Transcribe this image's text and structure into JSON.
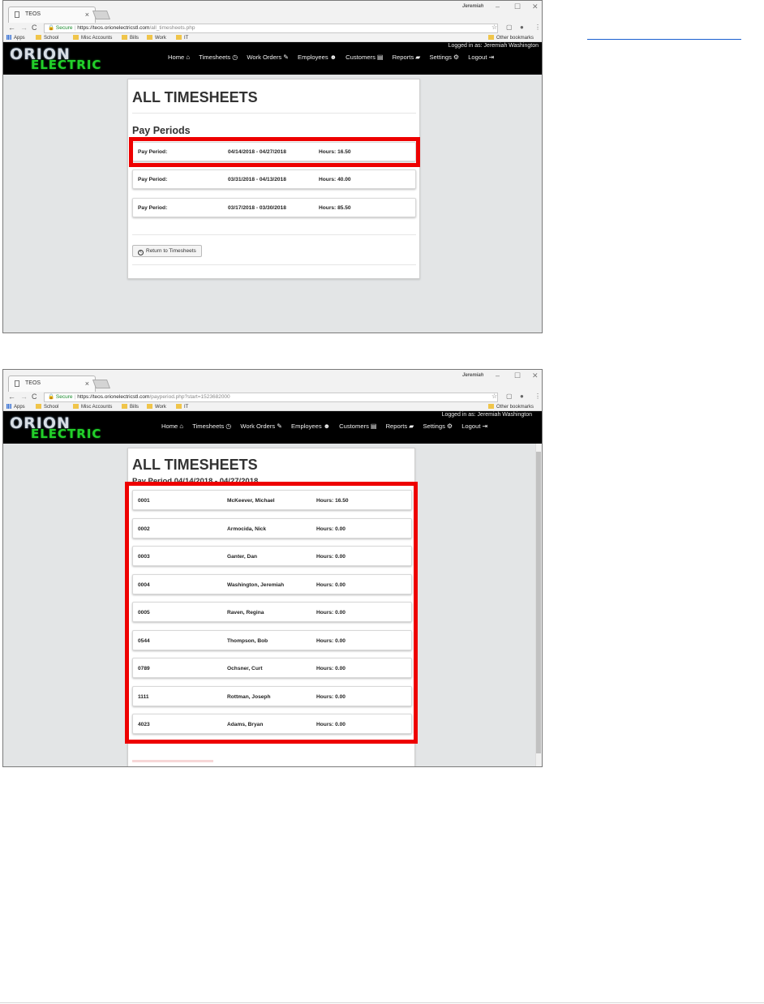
{
  "screenshot1": {
    "browser": {
      "tab_title": "TEOS",
      "user_label": "Jeremiah",
      "secure_label": "Secure",
      "url_host": "https://teos.orionelectricstl.com",
      "url_path": "/all_timesheets.php",
      "bookmarks": [
        "Apps",
        "School",
        "Misc Accounts",
        "Bills",
        "Work",
        "IT"
      ],
      "other_bookmarks": "Other bookmarks"
    },
    "site": {
      "logo_top": "ORION",
      "logo_bottom": "ELECTRIC",
      "logged_in": "Logged in as: Jeremiah Washington",
      "menu": [
        "Home",
        "Timesheets",
        "Work Orders",
        "Employees",
        "Customers",
        "Reports",
        "Settings",
        "Logout"
      ]
    },
    "page": {
      "title": "ALL TIMESHEETS",
      "subtitle": "Pay Periods",
      "periods": [
        {
          "label": "Pay Period:",
          "range": "04/14/2018 - 04/27/2018",
          "hours": "Hours: 16.50"
        },
        {
          "label": "Pay Period:",
          "range": "03/31/2018 - 04/13/2018",
          "hours": "Hours: 40.00"
        },
        {
          "label": "Pay Period:",
          "range": "03/17/2018 - 03/30/2018",
          "hours": "Hours: 85.50"
        }
      ],
      "return_button": "Return to Timesheets"
    }
  },
  "screenshot2": {
    "browser": {
      "tab_title": "TEOS",
      "user_label": "Jeremiah",
      "secure_label": "Secure",
      "url_host": "https://teos.orionelectricstl.com",
      "url_path": "/payperiod.php?start=1523682000",
      "bookmarks": [
        "Apps",
        "School",
        "Misc Accounts",
        "Bills",
        "Work",
        "IT"
      ],
      "other_bookmarks": "Other bookmarks"
    },
    "site": {
      "logo_top": "ORION",
      "logo_bottom": "ELECTRIC",
      "logged_in": "Logged in as: Jeremiah Washington",
      "menu": [
        "Home",
        "Timesheets",
        "Work Orders",
        "Employees",
        "Customers",
        "Reports",
        "Settings",
        "Logout"
      ]
    },
    "page": {
      "title": "ALL TIMESHEETS",
      "subtitle": "Pay Period 04/14/2018 - 04/27/2018",
      "employees": [
        {
          "id": "0001",
          "name": "McKeever, Michael",
          "hours": "Hours: 16.50"
        },
        {
          "id": "0002",
          "name": "Armocida, Nick",
          "hours": "Hours: 0.00"
        },
        {
          "id": "0003",
          "name": "Ganter, Dan",
          "hours": "Hours: 0.00"
        },
        {
          "id": "0004",
          "name": "Washington, Jeremiah",
          "hours": "Hours: 0.00"
        },
        {
          "id": "0005",
          "name": "Raven, Regina",
          "hours": "Hours: 0.00"
        },
        {
          "id": "0544",
          "name": "Thompson, Bob",
          "hours": "Hours: 0.00"
        },
        {
          "id": "0789",
          "name": "Ochsner, Curt",
          "hours": "Hours: 0.00"
        },
        {
          "id": "1111",
          "name": "Rottman, Joseph",
          "hours": "Hours: 0.00"
        },
        {
          "id": "4023",
          "name": "Adams, Bryan",
          "hours": "Hours: 0.00"
        }
      ]
    }
  },
  "colors": {
    "highlight": "#ee0000",
    "nav_bg": "#000000",
    "logo_green": "#22d12a",
    "page_bg": "#e3e5e6"
  }
}
